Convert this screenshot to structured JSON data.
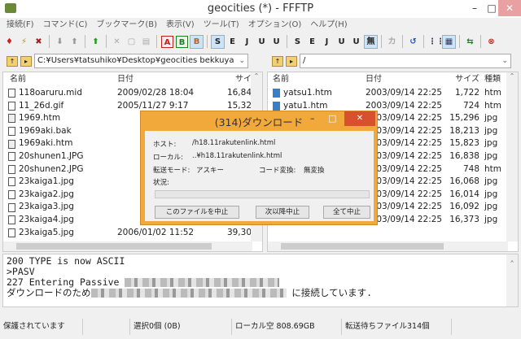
{
  "window": {
    "title": "geocities (*) - FFFTP",
    "minimize": "–",
    "maximize": "□",
    "close": "✕"
  },
  "menu": [
    "接続(F)",
    "コマンド(C)",
    "ブックマーク(B)",
    "表示(V)",
    "ツール(T)",
    "オプション(O)",
    "ヘルプ(H)"
  ],
  "toolbar": {
    "connect": "♦",
    "quick": "⚡",
    "disconnect": "✖",
    "download": "⬇",
    "upload": "⬆",
    "mirror": "⬆",
    "delete": "✕",
    "rename": "▢",
    "mkdir": "▤",
    "ascii": "A",
    "binary": "B",
    "auto": "B",
    "sjis1": "S",
    "euc1": "E",
    "jis1": "J",
    "utf8a": "U",
    "utf8b": "U",
    "sjis2": "S",
    "euc2": "E",
    "jis2": "J",
    "utf8c": "U",
    "utf8d": "U",
    "none": "無",
    "kana": "カ",
    "refresh": "↺",
    "list": "⋮⋮",
    "detail": "▦",
    "sync": "⇆",
    "stop": "⊗"
  },
  "local": {
    "path": "C:¥Users¥tatsuhiko¥Desktop¥geocities bekkuya",
    "headers": {
      "name": "名前",
      "date": "日付",
      "size": "サイ"
    },
    "rows": [
      {
        "name": "118oaruru.mid",
        "date": "2009/02/28 18:04",
        "size": "16,84",
        "type": "file"
      },
      {
        "name": "11_26d.gif",
        "date": "2005/11/27  9:17",
        "size": "15,32",
        "type": "file"
      },
      {
        "name": "1969.htm",
        "date": "",
        "size": "",
        "type": "doc"
      },
      {
        "name": "1969aki.bak",
        "date": "",
        "size": "",
        "type": "file"
      },
      {
        "name": "1969aki.htm",
        "date": "",
        "size": "",
        "type": "doc"
      },
      {
        "name": "20shunen1.JPG",
        "date": "",
        "size": "",
        "type": "file"
      },
      {
        "name": "20shunen2.JPG",
        "date": "",
        "size": "",
        "type": "file"
      },
      {
        "name": "23kaiga1.jpg",
        "date": "",
        "size": "",
        "type": "file"
      },
      {
        "name": "23kaiga2.jpg",
        "date": "",
        "size": "",
        "type": "file"
      },
      {
        "name": "23kaiga3.jpg",
        "date": "",
        "size": "",
        "type": "file"
      },
      {
        "name": "23kaiga4.jpg",
        "date": "",
        "size": "",
        "type": "file"
      },
      {
        "name": "23kaiga5.jpg",
        "date": "2006/01/02 11:52",
        "size": "39,30",
        "type": "file"
      }
    ]
  },
  "remote": {
    "path": "/",
    "headers": {
      "name": "名前",
      "date": "日付",
      "size": "サイズ",
      "type": "種類"
    },
    "rows": [
      {
        "name": "yatsu1.htm",
        "date": "2003/09/14 22:25",
        "size": "1,722",
        "type": "htm"
      },
      {
        "name": "yatu1.htm",
        "date": "2003/09/14 22:25",
        "size": "724",
        "type": "htm"
      },
      {
        "name": "",
        "date": "2003/09/14 22:25",
        "size": "15,296",
        "type": "jpg"
      },
      {
        "name": "",
        "date": "2003/09/14 22:25",
        "size": "18,213",
        "type": "jpg"
      },
      {
        "name": "",
        "date": "2003/09/14 22:25",
        "size": "15,823",
        "type": "jpg"
      },
      {
        "name": "",
        "date": "2003/09/14 22:25",
        "size": "16,838",
        "type": "jpg"
      },
      {
        "name": "",
        "date": "2003/09/14 22:25",
        "size": "748",
        "type": "htm"
      },
      {
        "name": "",
        "date": "2003/09/14 22:25",
        "size": "16,068",
        "type": "jpg"
      },
      {
        "name": "",
        "date": "2003/09/14 22:25",
        "size": "16,014",
        "type": "jpg"
      },
      {
        "name": "",
        "date": "2003/09/14 22:25",
        "size": "16,092",
        "type": "jpg"
      },
      {
        "name": "",
        "date": "2003/09/14 22:25",
        "size": "16,373",
        "type": "jpg"
      }
    ]
  },
  "log": {
    "line1": "200 TYPE is now ASCII",
    "line2": ">PASV",
    "line3": "227 Entering Passive ",
    "line4a": "ダウンロードのため",
    "line4b": " に接続しています."
  },
  "status": {
    "protect": "保護されています",
    "selection": "選択0個 (0B)",
    "local_free": "ローカル空 808.69GB",
    "queue": "転送待ちファイル314個"
  },
  "dialog": {
    "title": "(314)ダウンロード",
    "host_label": "ホスト:",
    "host": "/h18.11rakutenlink.html",
    "local_label": "ローカル:",
    "local": "..¥h18.11rakutenlink.html",
    "mode_label": "転送モード:",
    "mode": "アスキー",
    "conv_label": "コード変換:",
    "conv": "無変換",
    "status_label": "状況:",
    "progress": 0,
    "btn_file": "このファイルを中止",
    "btn_next": "次以降中止",
    "btn_all": "全て中止"
  }
}
